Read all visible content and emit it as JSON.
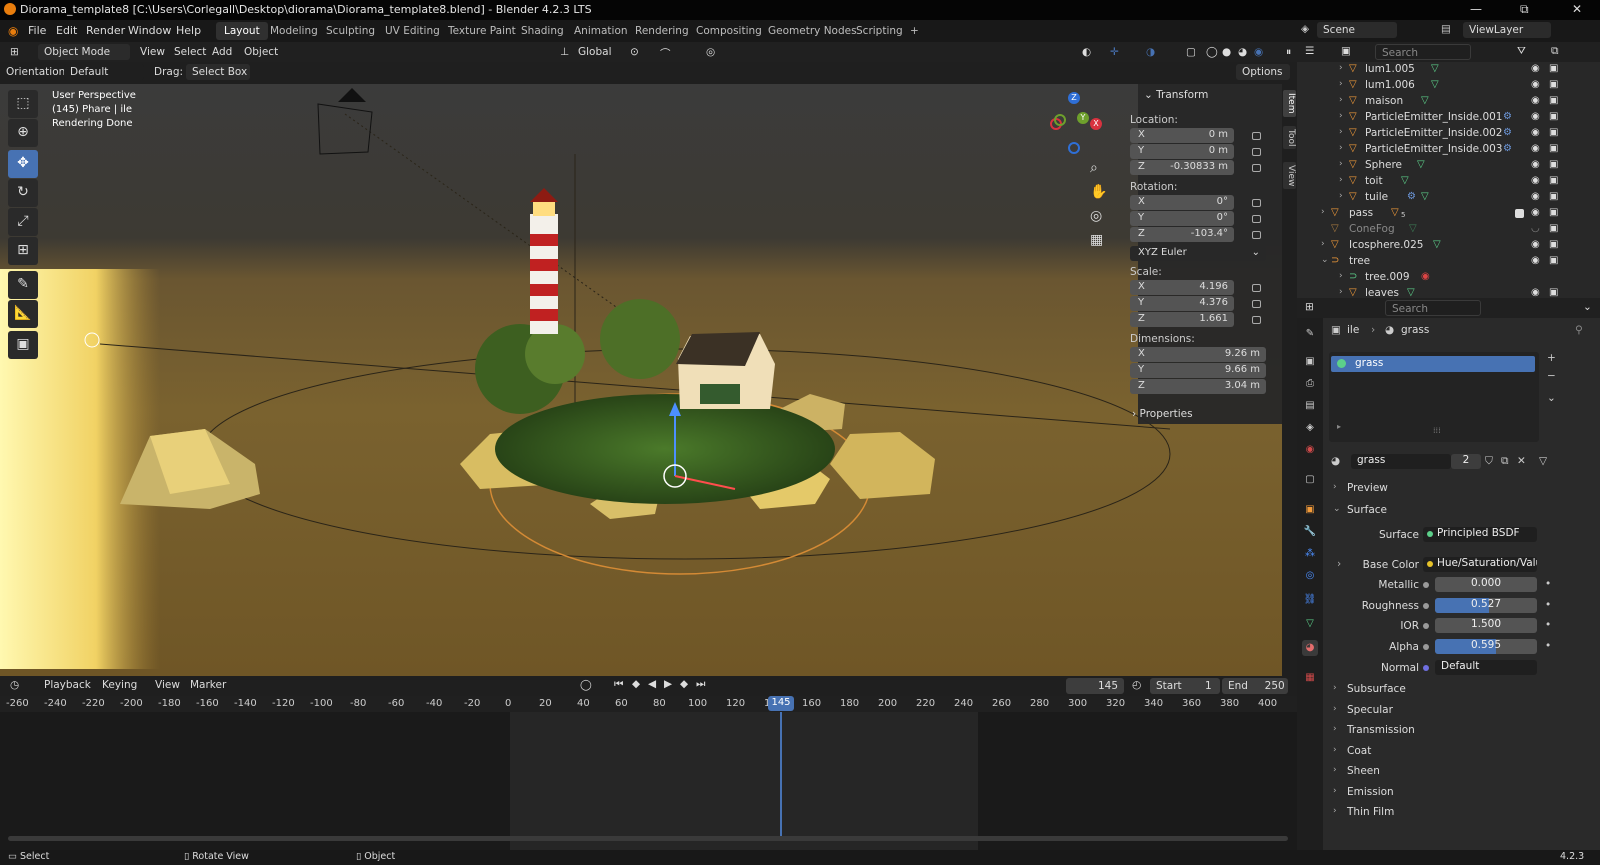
{
  "window": {
    "title": "Diorama_template8 [C:\\Users\\Corlegall\\Desktop\\diorama\\Diorama_template8.blend] - Blender 4.2.3 LTS",
    "min": "—",
    "restore": "⧉",
    "close": "✕"
  },
  "menu": [
    "File",
    "Edit",
    "Render",
    "Window",
    "Help"
  ],
  "workspaces": [
    "Layout",
    "Modeling",
    "Sculpting",
    "UV Editing",
    "Texture Paint",
    "Shading",
    "Animation",
    "Rendering",
    "Compositing",
    "Geometry Nodes",
    "Scripting"
  ],
  "workspace_add": "+",
  "active_workspace": "Layout",
  "scene": {
    "name": "Scene",
    "viewlayer": "ViewLayer"
  },
  "viewport_header": {
    "mode": "Object Mode",
    "menus": [
      "View",
      "Select",
      "Add",
      "Object"
    ],
    "transform_orientation": "Global",
    "orientation_label": "Orientation:",
    "orientation_value": "Default",
    "drag_label": "Drag:",
    "drag_value": "Select Box",
    "options": "Options"
  },
  "viewport_overlay": {
    "line1": "User Perspective",
    "line2": "(145) Phare | ile",
    "line3": "Rendering Done"
  },
  "gizmo": {
    "x": "X",
    "y": "Y",
    "z": "Z"
  },
  "npanel": {
    "title": "Transform",
    "location_label": "Location:",
    "location": [
      {
        "axis": "X",
        "value": "0 m"
      },
      {
        "axis": "Y",
        "value": "0 m"
      },
      {
        "axis": "Z",
        "value": "-0.30833 m"
      }
    ],
    "rotation_label": "Rotation:",
    "rotation": [
      {
        "axis": "X",
        "value": "0°"
      },
      {
        "axis": "Y",
        "value": "0°"
      },
      {
        "axis": "Z",
        "value": "-103.4°"
      }
    ],
    "rotation_mode": "XYZ Euler",
    "scale_label": "Scale:",
    "scale": [
      {
        "axis": "X",
        "value": "4.196"
      },
      {
        "axis": "Y",
        "value": "4.376"
      },
      {
        "axis": "Z",
        "value": "1.661"
      }
    ],
    "dimensions_label": "Dimensions:",
    "dimensions": [
      {
        "axis": "X",
        "value": "9.26 m"
      },
      {
        "axis": "Y",
        "value": "9.66 m"
      },
      {
        "axis": "Z",
        "value": "3.04 m"
      }
    ],
    "properties": "Properties",
    "tabs": [
      "Item",
      "Tool",
      "View"
    ]
  },
  "outliner": {
    "search_placeholder": "Search",
    "rows": [
      {
        "name": "lum1.005",
        "indent": 2
      },
      {
        "name": "lum1.006",
        "indent": 2
      },
      {
        "name": "maison",
        "indent": 2
      },
      {
        "name": "ParticleEmitter_Inside.001",
        "indent": 2
      },
      {
        "name": "ParticleEmitter_Inside.002",
        "indent": 2
      },
      {
        "name": "ParticleEmitter_Inside.003",
        "indent": 2
      },
      {
        "name": "Sphere",
        "indent": 2
      },
      {
        "name": "toit",
        "indent": 2
      },
      {
        "name": "tuile",
        "indent": 2
      },
      {
        "name": "pass",
        "indent": 1,
        "badge": "5"
      },
      {
        "name": "ConeFog",
        "indent": 1
      },
      {
        "name": "Icosphere.025",
        "indent": 1
      },
      {
        "name": "tree",
        "indent": 1
      },
      {
        "name": "tree.009",
        "indent": 2
      },
      {
        "name": "leaves",
        "indent": 2
      }
    ]
  },
  "properties_panel": {
    "search_placeholder": "Search",
    "breadcrumb_object": "ile",
    "breadcrumb_material": "grass",
    "slot": "grass",
    "material_name": "grass",
    "users": "2",
    "preview": "Preview",
    "surface_section": "Surface",
    "surface_label": "Surface",
    "surface_value": "Principled BSDF",
    "base_color_label": "Base Color",
    "base_color_value": "Hue/Saturation/Value",
    "metallic_label": "Metallic",
    "metallic_value": "0.000",
    "metallic_fill": 0.0,
    "roughness_label": "Roughness",
    "roughness_value": "0.527",
    "roughness_fill": 0.527,
    "ior_label": "IOR",
    "ior_value": "1.500",
    "ior_fill": 0.0,
    "alpha_label": "Alpha",
    "alpha_value": "0.595",
    "alpha_fill": 0.595,
    "normal_label": "Normal",
    "normal_value": "Default",
    "subsections": [
      "Subsurface",
      "Specular",
      "Transmission",
      "Coat",
      "Sheen",
      "Emission",
      "Thin Film"
    ]
  },
  "timeline": {
    "menus": [
      "Playback",
      "Keying",
      "View",
      "Marker"
    ],
    "current_frame": "145",
    "start_label": "Start",
    "start": "1",
    "end_label": "End",
    "end": "250",
    "ticks": [
      "-260",
      "-240",
      "-220",
      "-200",
      "-180",
      "-160",
      "-140",
      "-120",
      "-100",
      "-80",
      "-60",
      "-40",
      "-20",
      "0",
      "20",
      "40",
      "60",
      "80",
      "100",
      "120",
      "1",
      "160",
      "180",
      "200",
      "220",
      "240",
      "260",
      "280",
      "300",
      "320",
      "340",
      "360",
      "380",
      "400"
    ],
    "playhead_label": "145"
  },
  "statusbar": {
    "select": "Select",
    "rotate": "Rotate View",
    "object": "Object",
    "version": "4.2.3"
  },
  "colors": {
    "accent": "#4772b3",
    "orange": "#e87d0d",
    "mesh_icon": "#f29b3a",
    "data_icon": "#5cd08a"
  }
}
